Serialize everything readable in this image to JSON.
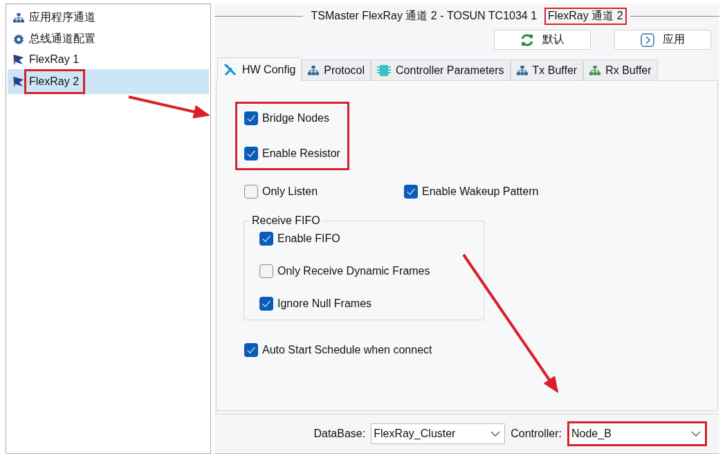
{
  "sidebar": {
    "items": [
      {
        "kind": "network",
        "label": "应用程序通道",
        "selected": false,
        "highlighted": false
      },
      {
        "kind": "gear",
        "label": "总线通道配置",
        "selected": false,
        "highlighted": false
      },
      {
        "kind": "flag",
        "label": "FlexRay 1",
        "selected": false,
        "highlighted": false
      },
      {
        "kind": "flag",
        "label": "FlexRay 2",
        "selected": true,
        "highlighted": true
      }
    ]
  },
  "title_parts": [
    {
      "text": "TSMaster FlexRay 通道 2 - TOSUN TC1034 1",
      "highlighted": false
    },
    {
      "text": "FlexRay 通道 2",
      "highlighted": true
    }
  ],
  "buttons": [
    {
      "kind": "refresh",
      "label": "默认"
    },
    {
      "kind": "apply",
      "label": "应用"
    }
  ],
  "tabs": [
    {
      "kind": "tools",
      "label": "HW Config",
      "selected": true
    },
    {
      "kind": "network",
      "label": "Protocol",
      "selected": false
    },
    {
      "kind": "chip",
      "label": "Controller Parameters",
      "selected": false
    },
    {
      "kind": "network",
      "label": "Tx Buffer",
      "selected": false
    },
    {
      "kind": "network-green",
      "label": "Rx Buffer",
      "selected": false
    }
  ],
  "hw_config": {
    "highlighted_group": {
      "highlighted": true,
      "checkboxes": [
        {
          "label": "Bridge Nodes",
          "checked": true
        },
        {
          "label": "Enable Resistor",
          "checked": true
        }
      ]
    },
    "row": [
      {
        "label": "Only Listen",
        "checked": false
      },
      {
        "label": "Enable Wakeup Pattern",
        "checked": true
      }
    ],
    "receive_fifo": {
      "title": "Receive FIFO",
      "checkboxes": [
        {
          "label": "Enable FIFO",
          "checked": true
        },
        {
          "label": "Only Receive Dynamic Frames",
          "checked": false
        },
        {
          "label": "Ignore Null Frames",
          "checked": true
        }
      ]
    },
    "auto_start": {
      "label": "Auto Start Schedule when connect",
      "checked": true
    }
  },
  "footer": {
    "database": {
      "label": "DataBase:",
      "value": "FlexRay_Cluster",
      "highlighted": false
    },
    "controller": {
      "label": "Controller:",
      "value": "Node_B",
      "highlighted": true
    }
  }
}
